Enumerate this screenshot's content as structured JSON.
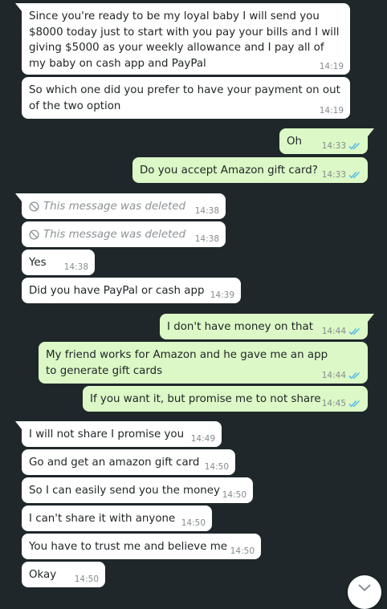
{
  "colors": {
    "chat_bg": "#1f272a",
    "incoming_bubble": "#ffffff",
    "outgoing_bubble": "#dcf8c6",
    "read_ticks": "#4fb6ec",
    "meta_text": "#868b8e"
  },
  "messages": [
    {
      "dir": "in",
      "text": "Since you're ready to be my loyal baby I will send you $8000 today just to start with you pay your bills and I will giving $5000 as your weekly allowance and I pay all of my baby on cash app and PayPal",
      "time": "14:19"
    },
    {
      "dir": "in",
      "text": "So which one did you prefer to have your payment on out of the two option",
      "time": "14:19"
    },
    {
      "dir": "out",
      "text": "Oh",
      "time": "14:33",
      "status": "read"
    },
    {
      "dir": "out",
      "text": "Do you accept Amazon gift card?",
      "time": "14:33",
      "status": "read"
    },
    {
      "dir": "in",
      "text": "This message was deleted",
      "time": "14:38",
      "deleted": true
    },
    {
      "dir": "in",
      "text": "This message was deleted",
      "time": "14:38",
      "deleted": true
    },
    {
      "dir": "in",
      "text": "Yes",
      "time": "14:38"
    },
    {
      "dir": "in",
      "text": "Did you have PayPal or cash app",
      "time": "14:39"
    },
    {
      "dir": "out",
      "text": "I don't have money on that",
      "time": "14:44",
      "status": "read"
    },
    {
      "dir": "out",
      "text": "My friend works for Amazon and he gave me an app to generate gift cards",
      "time": "14:44",
      "status": "read"
    },
    {
      "dir": "out",
      "text": "If you want it, but promise me to not share",
      "time": "14:45",
      "status": "read"
    },
    {
      "dir": "in",
      "text": "I will not share I promise you",
      "time": "14:49"
    },
    {
      "dir": "in",
      "text": "Go and get an amazon gift card",
      "time": "14:50"
    },
    {
      "dir": "in",
      "text": "So I can easily send you the money",
      "time": "14:50"
    },
    {
      "dir": "in",
      "text": "I can't share it with anyone",
      "time": "14:50"
    },
    {
      "dir": "in",
      "text": "You have to trust me and believe me",
      "time": "14:50"
    },
    {
      "dir": "in",
      "text": "Okay",
      "time": "14:50"
    }
  ],
  "scroll_button": {
    "icon": "chevron-down-icon"
  }
}
